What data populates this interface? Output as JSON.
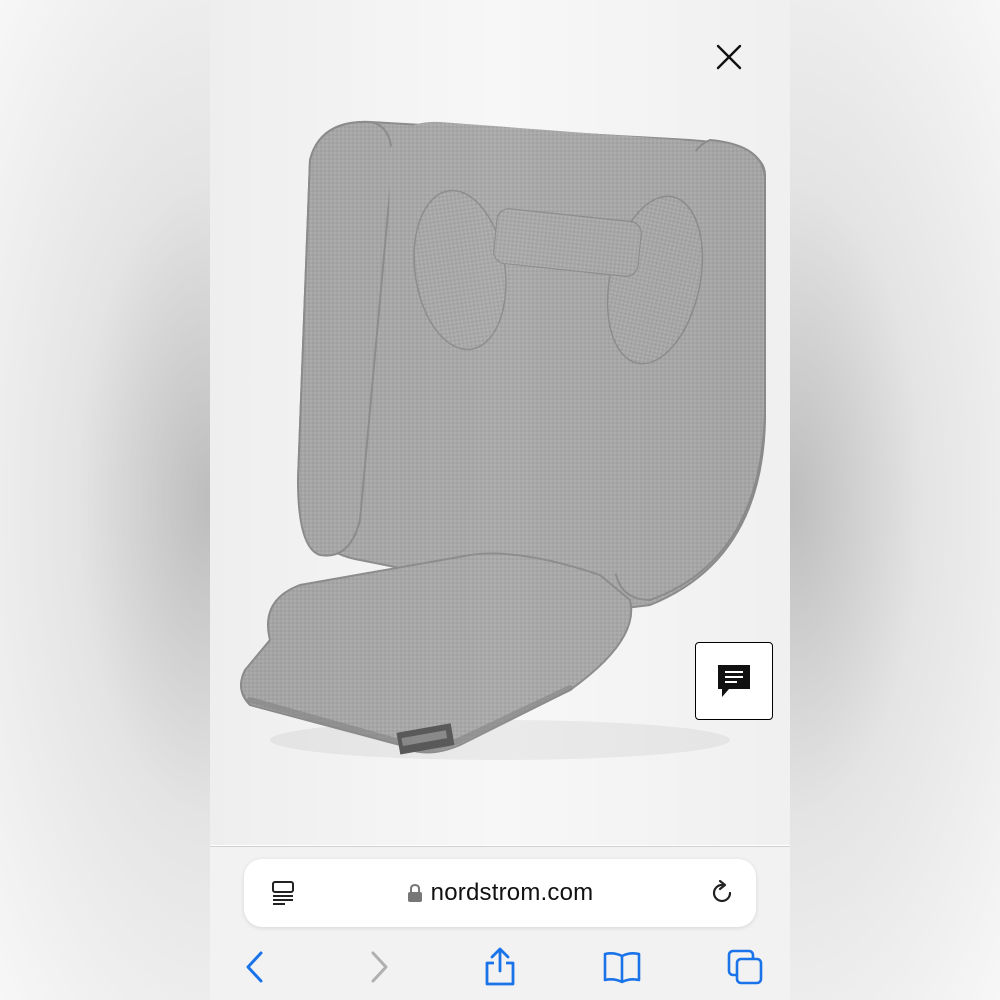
{
  "browser": {
    "url": "nordstrom.com"
  },
  "icons": {
    "close": "close-icon",
    "chat": "chat-icon",
    "reader": "reader-mode-icon",
    "lock": "lock-icon",
    "reload": "reload-icon",
    "back": "chevron-left-icon",
    "forward": "chevron-right-icon",
    "share": "share-icon",
    "bookmarks": "book-icon",
    "tabs": "tabs-icon"
  },
  "colors": {
    "accent": "#1a73e8",
    "disabled": "#b0b0b0",
    "product_gray": "#a6a6a6"
  }
}
